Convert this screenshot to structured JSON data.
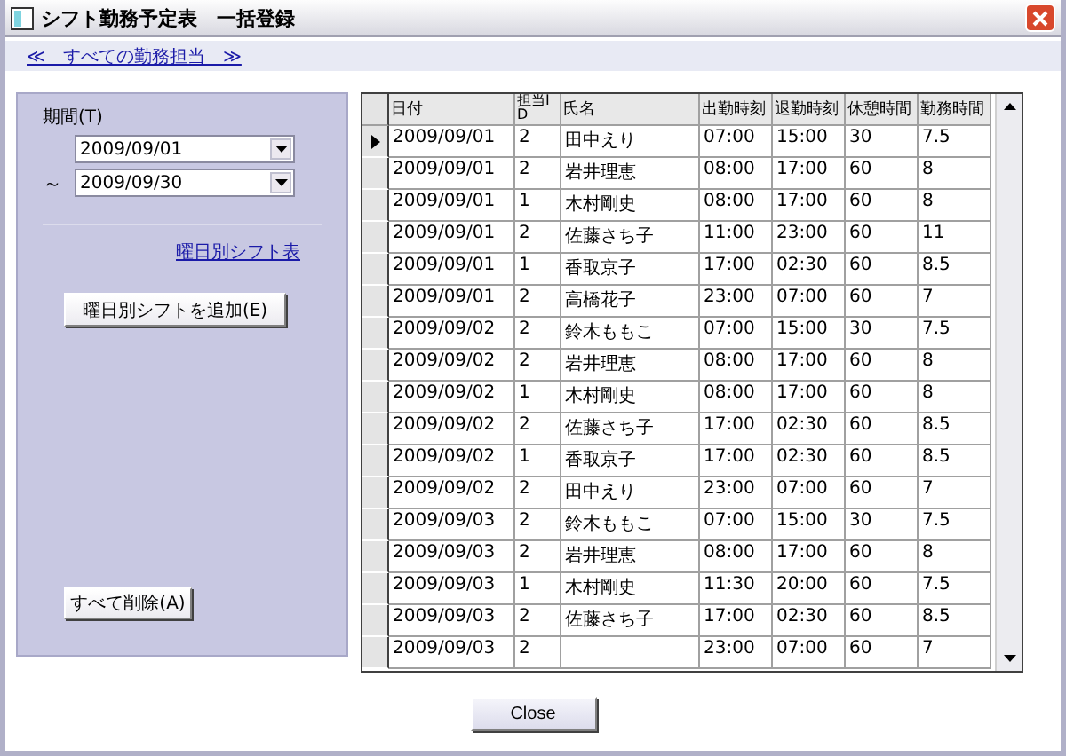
{
  "window": {
    "title": "シフト勤務予定表　一括登録"
  },
  "nav_link": "≪　すべての勤務担当　≫",
  "period": {
    "label": "期間(T)",
    "from": "2009/09/01",
    "separator": "～",
    "to": "2009/09/30"
  },
  "weekday_link": "曜日別シフト表",
  "add_button": "曜日別シフトを追加(E)",
  "delete_all_button": "すべて削除(A)",
  "table": {
    "columns": [
      "日付",
      "担当ID",
      "氏名",
      "出勤時刻",
      "退勤時刻",
      "休憩時間",
      "勤務時間"
    ],
    "rows": [
      {
        "selected": true,
        "cells": [
          "2009/09/01",
          "2",
          "田中えり",
          "07:00",
          "15:00",
          "30",
          "7.5"
        ]
      },
      {
        "selected": false,
        "cells": [
          "2009/09/01",
          "2",
          "岩井理恵",
          "08:00",
          "17:00",
          "60",
          "8"
        ]
      },
      {
        "selected": false,
        "cells": [
          "2009/09/01",
          "1",
          "木村剛史",
          "08:00",
          "17:00",
          "60",
          "8"
        ]
      },
      {
        "selected": false,
        "cells": [
          "2009/09/01",
          "2",
          "佐藤さち子",
          "11:00",
          "23:00",
          "60",
          "11"
        ]
      },
      {
        "selected": false,
        "cells": [
          "2009/09/01",
          "1",
          "香取京子",
          "17:00",
          "02:30",
          "60",
          "8.5"
        ]
      },
      {
        "selected": false,
        "cells": [
          "2009/09/01",
          "2",
          "高橋花子",
          "23:00",
          "07:00",
          "60",
          "7"
        ]
      },
      {
        "selected": false,
        "cells": [
          "2009/09/02",
          "2",
          "鈴木ももこ",
          "07:00",
          "15:00",
          "30",
          "7.5"
        ]
      },
      {
        "selected": false,
        "cells": [
          "2009/09/02",
          "2",
          "岩井理恵",
          "08:00",
          "17:00",
          "60",
          "8"
        ]
      },
      {
        "selected": false,
        "cells": [
          "2009/09/02",
          "1",
          "木村剛史",
          "08:00",
          "17:00",
          "60",
          "8"
        ]
      },
      {
        "selected": false,
        "cells": [
          "2009/09/02",
          "2",
          "佐藤さち子",
          "17:00",
          "02:30",
          "60",
          "8.5"
        ]
      },
      {
        "selected": false,
        "cells": [
          "2009/09/02",
          "1",
          "香取京子",
          "17:00",
          "02:30",
          "60",
          "8.5"
        ]
      },
      {
        "selected": false,
        "cells": [
          "2009/09/02",
          "2",
          "田中えり",
          "23:00",
          "07:00",
          "60",
          "7"
        ]
      },
      {
        "selected": false,
        "cells": [
          "2009/09/03",
          "2",
          "鈴木ももこ",
          "07:00",
          "15:00",
          "30",
          "7.5"
        ]
      },
      {
        "selected": false,
        "cells": [
          "2009/09/03",
          "2",
          "岩井理恵",
          "08:00",
          "17:00",
          "60",
          "8"
        ]
      },
      {
        "selected": false,
        "cells": [
          "2009/09/03",
          "1",
          "木村剛史",
          "11:30",
          "20:00",
          "60",
          "7.5"
        ]
      },
      {
        "selected": false,
        "cells": [
          "2009/09/03",
          "2",
          "佐藤さち子",
          "17:00",
          "02:30",
          "60",
          "8.5"
        ]
      },
      {
        "selected": false,
        "cells": [
          "2009/09/03",
          "2",
          "",
          "23:00",
          "07:00",
          "60",
          "7"
        ]
      }
    ]
  },
  "close_button": "Close"
}
